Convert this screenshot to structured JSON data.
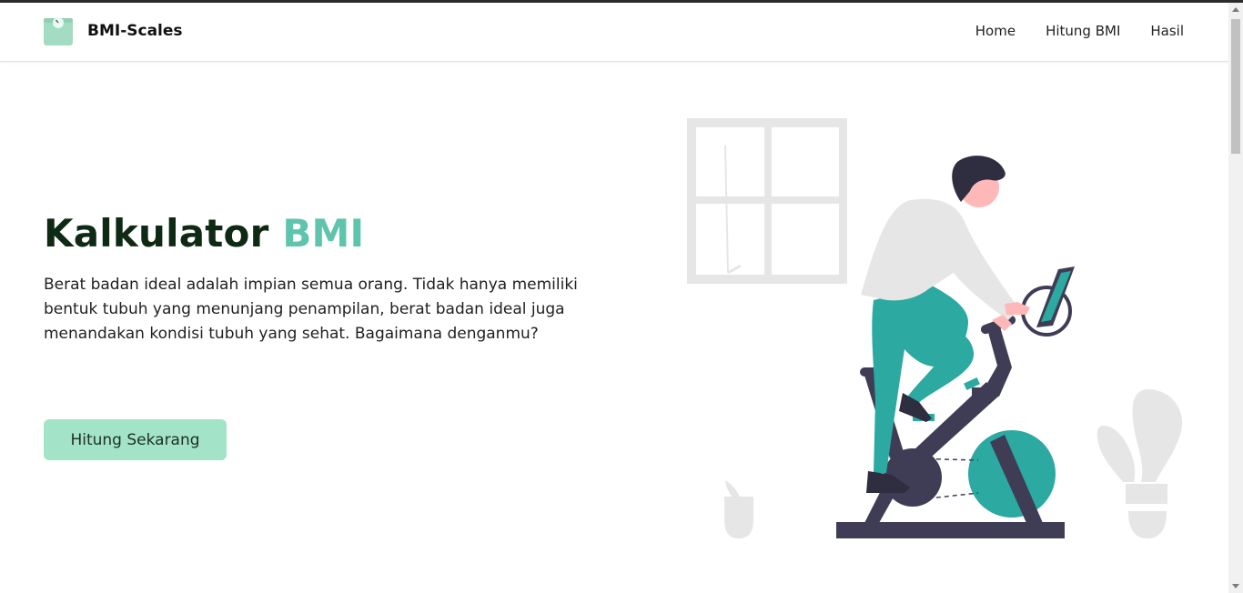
{
  "brand": {
    "name": "BMI-Scales",
    "logo_icon": "scale-icon"
  },
  "nav": {
    "items": [
      {
        "label": "Home"
      },
      {
        "label": "Hitung BMI"
      },
      {
        "label": "Hasil"
      }
    ]
  },
  "hero": {
    "title_main": "Kalkulator",
    "title_accent": "BMI",
    "description": "Berat badan ideal adalah impian semua orang. Tidak hanya memiliki bentuk tubuh yang menunjang penampilan, berat badan ideal juga menandakan kondisi tubuh yang sehat. Bagaimana denganmu?",
    "cta_label": "Hitung Sekarang"
  },
  "illustration": {
    "icon": "exercise-bike-illustration"
  },
  "colors": {
    "accent": "#5fc4ac",
    "button": "#a3e4c8",
    "teal": "#2ca9a1",
    "dark": "#3f3d56",
    "title": "#0e2a14"
  }
}
